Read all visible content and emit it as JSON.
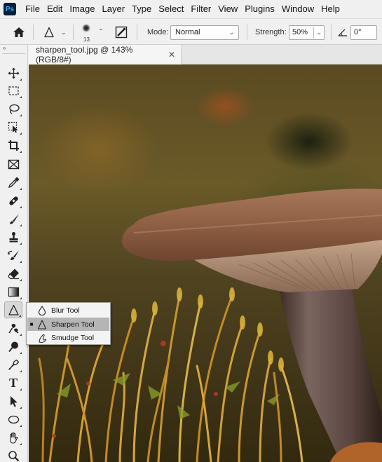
{
  "menubar": {
    "logo": "Ps",
    "items": [
      "File",
      "Edit",
      "Image",
      "Layer",
      "Type",
      "Select",
      "Filter",
      "View",
      "Plugins",
      "Window",
      "Help"
    ]
  },
  "options": {
    "home_icon": "home-icon",
    "tool_preset_icon": "sharpen-tool-icon",
    "brush_size": "13",
    "mode_label": "Mode:",
    "mode_value": "Normal",
    "strength_label": "Strength:",
    "strength_value": "50%",
    "angle_value": "0°"
  },
  "document": {
    "tab_title": "sharpen_tool.jpg @ 143% (RGB/8#)",
    "close_glyph": "✕"
  },
  "tools": [
    "move-tool",
    "marquee-tool",
    "lasso-tool",
    "object-select-tool",
    "crop-tool",
    "frame-tool",
    "eyedropper-tool",
    "spot-healing-tool",
    "brush-tool",
    "clone-stamp-tool",
    "history-brush-tool",
    "eraser-tool",
    "gradient-tool",
    "sharpen-tool",
    "dodge-tool",
    "burn-tool",
    "pen-tool",
    "type-tool",
    "path-select-tool",
    "ellipse-tool",
    "hand-tool",
    "zoom-tool"
  ],
  "active_tool": "sharpen-tool",
  "type_tool_glyph": "T",
  "flyout": {
    "items": [
      {
        "label": "Blur Tool",
        "icon": "blur-drop-icon",
        "selected": false
      },
      {
        "label": "Sharpen Tool",
        "icon": "sharpen-triangle-icon",
        "selected": true
      },
      {
        "label": "Smudge Tool",
        "icon": "smudge-finger-icon",
        "selected": false
      }
    ],
    "selected_bullet": "■"
  },
  "colors": {
    "ps_logo_bg": "#001e36",
    "ps_logo_fg": "#31a8ff",
    "ui_bg": "#f0f0f0",
    "flyout_selected": "#b5b5b5"
  }
}
